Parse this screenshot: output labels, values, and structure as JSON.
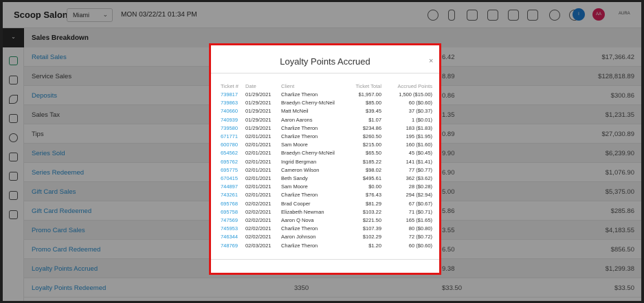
{
  "app": {
    "brand": "Scoop Salon",
    "location": "Miami",
    "datetime": "MON 03/22/21  01:34 PM",
    "user_initial": "I",
    "user_badge": "AA",
    "user_name": "AURA"
  },
  "colors": {
    "link": "#2a8fd0",
    "modal_border": "#e01616",
    "avatar_blue": "#1f7fd6",
    "avatar_pink": "#e0245e"
  },
  "sidebar": {
    "toggle_icon": "chevron-down-icon",
    "icons": [
      "register-icon",
      "calendar-icon",
      "services-icon",
      "clients-icon",
      "account-icon",
      "inventory-icon",
      "reports-icon",
      "marketing-icon",
      "settings-icon"
    ]
  },
  "report": {
    "section_title": "Sales Breakdown",
    "rows": [
      {
        "label": "Retail Sales",
        "link": true,
        "count": "",
        "mid": "6.42",
        "total": "$17,366.42"
      },
      {
        "label": "Service Sales",
        "link": false,
        "count": "",
        "mid": "8.89",
        "total": "$128,818.89"
      },
      {
        "label": "Deposits",
        "link": true,
        "count": "",
        "mid": "0.86",
        "total": "$300.86"
      },
      {
        "label": "Sales Tax",
        "link": false,
        "count": "",
        "mid": "1.35",
        "total": "$1,231.35"
      },
      {
        "label": "Tips",
        "link": false,
        "count": "",
        "mid": "0.89",
        "total": "$27,030.89"
      },
      {
        "label": "Series Sold",
        "link": true,
        "count": "",
        "mid": "9.90",
        "total": "$6,239.90"
      },
      {
        "label": "Series Redeemed",
        "link": true,
        "count": "",
        "mid": "6.90",
        "total": "$1,076.90"
      },
      {
        "label": "Gift Card Sales",
        "link": true,
        "count": "",
        "mid": "5.00",
        "total": "$5,375.00"
      },
      {
        "label": "Gift Card Redeemed",
        "link": true,
        "count": "",
        "mid": "5.86",
        "total": "$285.86"
      },
      {
        "label": "Promo Card Sales",
        "link": true,
        "count": "",
        "mid": "3.55",
        "total": "$4,183.55"
      },
      {
        "label": "Promo Card Redeemed",
        "link": true,
        "count": "",
        "mid": "6.50",
        "total": "$856.50"
      },
      {
        "label": "Loyalty Points Accrued",
        "link": true,
        "count": "",
        "mid": "9.38",
        "total": "$1,299.38"
      },
      {
        "label": "Loyalty Points Redeemed",
        "link": true,
        "count": "3350",
        "mid": "$33.50",
        "total": "$33.50"
      }
    ]
  },
  "modal": {
    "title": "Loyalty Points Accrued",
    "close_glyph": "×",
    "headers": {
      "ticket": "Ticket #",
      "date": "Date",
      "client": "Client",
      "total": "Ticket Total",
      "points": "Accrued Points"
    },
    "rows": [
      {
        "ticket": "739817",
        "date": "01/29/2021",
        "client": "Charlize Theron",
        "total": "$1,957.00",
        "points": "1,500 ($15.00)"
      },
      {
        "ticket": "739863",
        "date": "01/29/2021",
        "client": "Braedyn Cherry-McNeil",
        "total": "$85.00",
        "points": "60 ($0.60)"
      },
      {
        "ticket": "740660",
        "date": "01/29/2021",
        "client": "Matt McNeil",
        "total": "$39.45",
        "points": "37 ($0.37)"
      },
      {
        "ticket": "740939",
        "date": "01/29/2021",
        "client": "Aaron Aarons",
        "total": "$1.07",
        "points": "1 ($0.01)"
      },
      {
        "ticket": "739580",
        "date": "01/29/2021",
        "client": "Charlize Theron",
        "total": "$234.86",
        "points": "183 ($1.83)"
      },
      {
        "ticket": "671771",
        "date": "02/01/2021",
        "client": "Charlize Theron",
        "total": "$260.50",
        "points": "195 ($1.95)"
      },
      {
        "ticket": "600780",
        "date": "02/01/2021",
        "client": "Sam Moore",
        "total": "$215.00",
        "points": "160 ($1.60)"
      },
      {
        "ticket": "654562",
        "date": "02/01/2021",
        "client": "Braedyn Cherry-McNeil",
        "total": "$65.50",
        "points": "45 ($0.45)"
      },
      {
        "ticket": "695762",
        "date": "02/01/2021",
        "client": "Ingrid Bergman",
        "total": "$185.22",
        "points": "141 ($1.41)"
      },
      {
        "ticket": "695775",
        "date": "02/01/2021",
        "client": "Cameron Wilson",
        "total": "$98.02",
        "points": "77 ($0.77)"
      },
      {
        "ticket": "670415",
        "date": "02/01/2021",
        "client": "Beth Sandy",
        "total": "$495.61",
        "points": "362 ($3.62)"
      },
      {
        "ticket": "744897",
        "date": "02/01/2021",
        "client": "Sam Moore",
        "total": "$0.00",
        "points": "28 ($0.28)"
      },
      {
        "ticket": "743261",
        "date": "02/01/2021",
        "client": "Charlize Theron",
        "total": "$76.43",
        "points": "294 ($2.94)"
      },
      {
        "ticket": "695768",
        "date": "02/02/2021",
        "client": "Brad Cooper",
        "total": "$81.29",
        "points": "67 ($0.67)"
      },
      {
        "ticket": "695758",
        "date": "02/02/2021",
        "client": "Elizabeth Newman",
        "total": "$103.22",
        "points": "71 ($0.71)"
      },
      {
        "ticket": "747569",
        "date": "02/02/2021",
        "client": "Aaron Q Nova",
        "total": "$221.50",
        "points": "165 ($1.65)"
      },
      {
        "ticket": "745953",
        "date": "02/02/2021",
        "client": "Charlize Theron",
        "total": "$107.39",
        "points": "80 ($0.80)"
      },
      {
        "ticket": "746344",
        "date": "02/02/2021",
        "client": "Aaron Johnson",
        "total": "$102.29",
        "points": "72 ($0.72)"
      },
      {
        "ticket": "748769",
        "date": "02/03/2021",
        "client": "Charlize Theron",
        "total": "$1.20",
        "points": "60 ($0.60)"
      }
    ]
  }
}
